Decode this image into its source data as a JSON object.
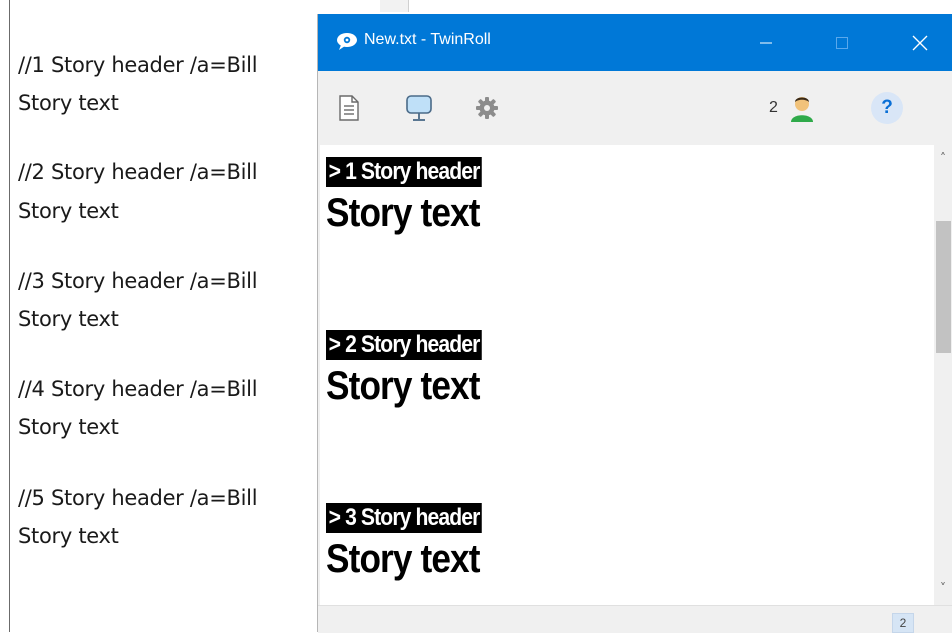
{
  "editor": {
    "lines": [
      {
        "header": "//1 Story header /a=Bill",
        "text": "Story text"
      },
      {
        "header": "//2 Story header /a=Bill",
        "text": "Story text"
      },
      {
        "header": "//3 Story header /a=Bill",
        "text": "Story text"
      },
      {
        "header": "//4 Story header /a=Bill",
        "text": "Story text"
      },
      {
        "header": "//5 Story header /a=Bill",
        "text": "Story text"
      }
    ]
  },
  "window": {
    "title": "New.txt - TwinRoll",
    "title_bar_color": "#0078d7",
    "controls": {
      "minimize": "—",
      "maximize": "☐",
      "close": "✕"
    }
  },
  "toolbar": {
    "icons": [
      "document-icon",
      "monitor-icon",
      "gear-icon"
    ],
    "user_count": "2",
    "help_label": "?"
  },
  "prompter": {
    "stories": [
      {
        "header": "> 1 Story header",
        "text": "Story text"
      },
      {
        "header": "> 2 Story header",
        "text": "Story text"
      },
      {
        "header": "> 3 Story header",
        "text": "Story text"
      }
    ]
  },
  "scrollbar": {
    "up_arrow": "˄",
    "down_arrow": "˅"
  },
  "status": {
    "badge": "2"
  }
}
